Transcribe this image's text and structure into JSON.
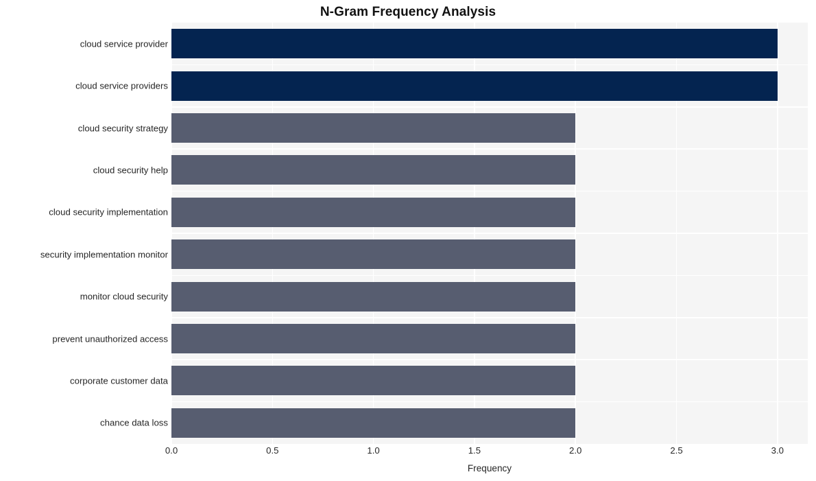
{
  "chart_data": {
    "type": "bar",
    "orientation": "horizontal",
    "title": "N-Gram Frequency Analysis",
    "xlabel": "Frequency",
    "ylabel": "",
    "categories": [
      "cloud service provider",
      "cloud service providers",
      "cloud security strategy",
      "cloud security help",
      "cloud security implementation",
      "security implementation monitor",
      "monitor cloud security",
      "prevent unauthorized access",
      "corporate customer data",
      "chance data loss"
    ],
    "values": [
      3,
      3,
      2,
      2,
      2,
      2,
      2,
      2,
      2,
      2
    ],
    "bar_colors": [
      "#042450",
      "#042450",
      "#575d70",
      "#575d70",
      "#575d70",
      "#575d70",
      "#575d70",
      "#575d70",
      "#575d70",
      "#575d70"
    ],
    "xlim": [
      0.0,
      3.15
    ],
    "xticks": [
      0.0,
      0.5,
      1.0,
      1.5,
      2.0,
      2.5,
      3.0
    ],
    "xtick_labels": [
      "0.0",
      "0.5",
      "1.0",
      "1.5",
      "2.0",
      "2.5",
      "3.0"
    ],
    "grid": true,
    "grid_color": "#ffffff",
    "plot_background": "#f5f5f5",
    "figure_background": "#ffffff",
    "legend": null,
    "legend_position": "none"
  }
}
